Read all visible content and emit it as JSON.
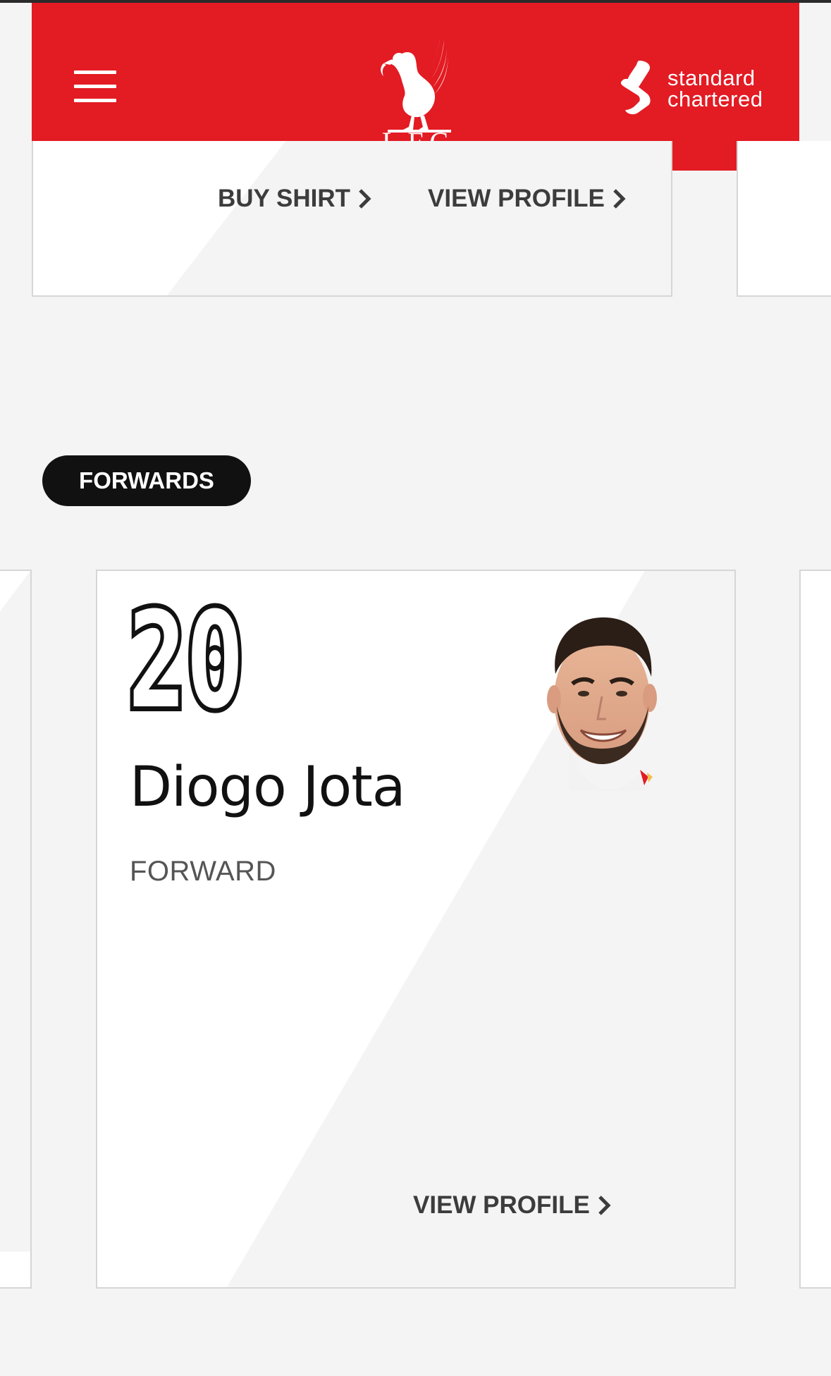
{
  "header": {
    "menu_icon": "hamburger-menu-icon",
    "crest_text": "L.F.C.",
    "sponsor_line1": "standard",
    "sponsor_line2": "chartered",
    "colors": {
      "brand_red": "#e31b23",
      "text_white": "#ffffff"
    }
  },
  "previous_card": {
    "buy_shirt_label": "BUY SHIRT",
    "view_profile_label": "VIEW PROFILE"
  },
  "section": {
    "label": "FORWARDS"
  },
  "player": {
    "number": "20",
    "name": "Diogo Jota",
    "position": "FORWARD",
    "view_profile_label": "VIEW PROFILE"
  }
}
